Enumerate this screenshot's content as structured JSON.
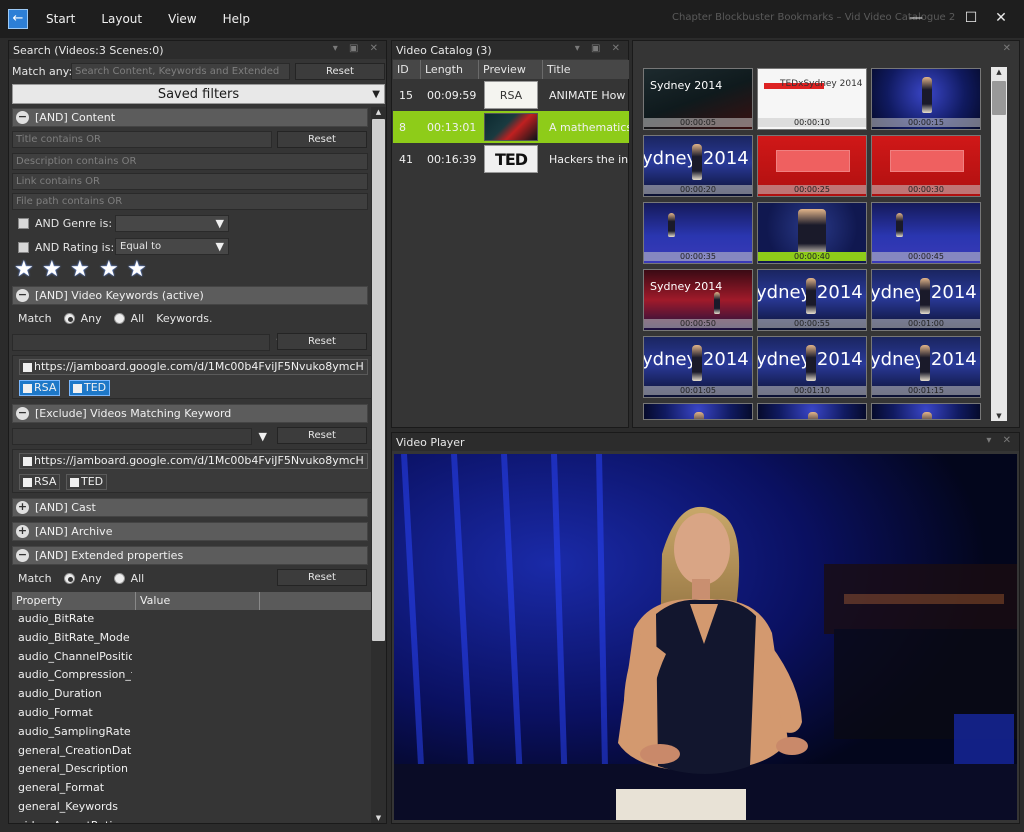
{
  "window": {
    "title": "Chapter Blockbuster Bookmarks – Vid Video Catalogue 2"
  },
  "menu": [
    "Start",
    "Layout",
    "View",
    "Help"
  ],
  "search": {
    "header": "Search (Videos:3 Scenes:0)",
    "match_any_label": "Match any:",
    "match_any_placeholder": "Search Content, Keywords and Extended",
    "reset": "Reset",
    "saved_filters": "Saved filters",
    "content_section": "[AND] Content",
    "title_placeholder": "Title contains OR",
    "description_placeholder": "Description contains OR",
    "link_placeholder": "Link contains OR",
    "filepath_placeholder": "File path contains OR",
    "genre_label": "AND Genre is:",
    "genre_value": "",
    "rating_label": "AND Rating is:",
    "rating_op": "Equal to",
    "rating_stars": 5,
    "keywords_section": "[AND] Video Keywords (active)",
    "match_label": "Match",
    "any_label": "Any",
    "all_label": "All",
    "keywords_label": "Keywords.",
    "keywords": [
      {
        "text": "https://jamboard.google.com/d/1Mc00b4FviJF5Nvuko8ymcH",
        "selected": false
      },
      {
        "text": "RSA",
        "selected": true
      },
      {
        "text": "TED",
        "selected": true
      }
    ],
    "exclude_section": "[Exclude] Videos Matching Keyword",
    "exclude_keywords": [
      {
        "text": "https://jamboard.google.com/d/1Mc00b4FviJF5Nvuko8ymcH",
        "selected": false
      },
      {
        "text": "RSA",
        "selected": false
      },
      {
        "text": "TED",
        "selected": false
      }
    ],
    "cast_section": "[AND] Cast",
    "archive_section": "[AND] Archive",
    "extended_section": "[AND] Extended properties",
    "prop_col_property": "Property",
    "prop_col_value": "Value",
    "properties": [
      "audio_BitRate",
      "audio_BitRate_Mode",
      "audio_ChannelPositio",
      "audio_Compression_f",
      "audio_Duration",
      "audio_Format",
      "audio_SamplingRate",
      "general_CreationDate",
      "general_Description",
      "general_Format",
      "general_Keywords",
      "video_AspectRatio"
    ]
  },
  "catalog": {
    "header": "Video Catalog (3)",
    "columns": [
      "ID",
      "Length",
      "Preview",
      "Title"
    ],
    "rows": [
      {
        "id": "15",
        "length": "00:09:59",
        "preview": "RSA",
        "title": "ANIMATE How",
        "selected": false
      },
      {
        "id": "8",
        "length": "00:13:01",
        "preview": "",
        "title": "A mathematics",
        "selected": true
      },
      {
        "id": "41",
        "length": "00:16:39",
        "preview": "TED",
        "title": "Hackers the in",
        "selected": false
      }
    ]
  },
  "scenes": {
    "items": [
      {
        "ts": "00:00:05",
        "kind": "title-dark",
        "label": "Sydney 2014",
        "selected": false
      },
      {
        "ts": "00:00:10",
        "kind": "title-white",
        "label": "TEDxSydney 2014",
        "selected": false
      },
      {
        "ts": "00:00:15",
        "kind": "speaker",
        "label": "",
        "selected": false
      },
      {
        "ts": "00:00:20",
        "kind": "sydney",
        "label": "ydney 2014",
        "selected": false
      },
      {
        "ts": "00:00:25",
        "kind": "red",
        "label": "",
        "selected": false
      },
      {
        "ts": "00:00:30",
        "kind": "red",
        "label": "",
        "selected": false
      },
      {
        "ts": "00:00:35",
        "kind": "audience",
        "label": "",
        "selected": false
      },
      {
        "ts": "00:00:40",
        "kind": "speaker-close",
        "label": "",
        "selected": true
      },
      {
        "ts": "00:00:45",
        "kind": "audience",
        "label": "",
        "selected": false
      },
      {
        "ts": "00:00:50",
        "kind": "stage-red",
        "label": "Sydney 2014",
        "selected": false
      },
      {
        "ts": "00:00:55",
        "kind": "sydney",
        "label": "ydney 2014",
        "selected": false
      },
      {
        "ts": "00:01:00",
        "kind": "sydney",
        "label": "ydney 2014",
        "selected": false
      },
      {
        "ts": "00:01:05",
        "kind": "sydney",
        "label": "ydney 2014",
        "selected": false
      },
      {
        "ts": "00:01:10",
        "kind": "sydney",
        "label": "ydney 2014",
        "selected": false
      },
      {
        "ts": "00:01:15",
        "kind": "sydney",
        "label": "ydney 2014",
        "selected": false
      },
      {
        "ts": "",
        "kind": "speaker",
        "label": "",
        "selected": false
      },
      {
        "ts": "",
        "kind": "speaker",
        "label": "",
        "selected": false
      },
      {
        "ts": "",
        "kind": "speaker",
        "label": "",
        "selected": false
      }
    ]
  },
  "player": {
    "header": "Video Player"
  },
  "colors": {
    "selection": "#8ecc19",
    "accent": "#2d7fd6",
    "panel": "#353535"
  }
}
